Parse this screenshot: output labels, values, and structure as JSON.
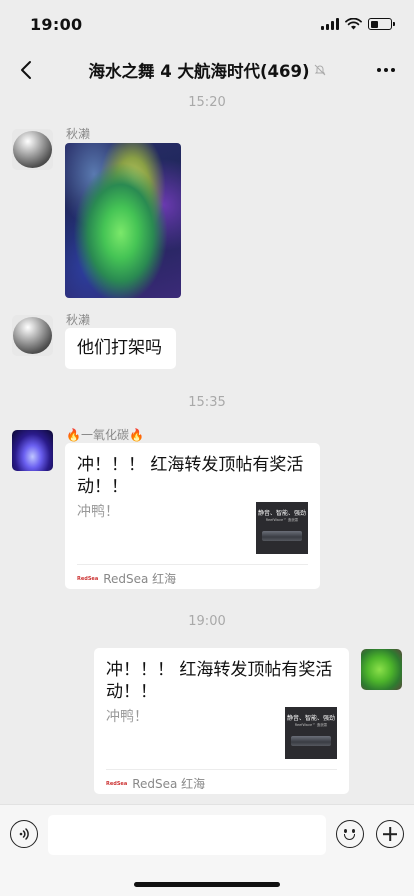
{
  "status_bar": {
    "time": "19:00"
  },
  "nav": {
    "title": "海水之舞 4 大航海时代(469)"
  },
  "messages": {
    "ts1": "15:20",
    "m1": {
      "sender": "秋濑"
    },
    "m2": {
      "sender": "秋濑",
      "text": "他们打架吗"
    },
    "ts2": "15:35",
    "m3": {
      "sender_prefix": "🔥",
      "sender_name": "一氧化碳",
      "sender_suffix": "🔥",
      "title_line1": "冲！！！ 红海转发顶帖有奖活",
      "title_line2": "动！！",
      "desc": "冲鸭！",
      "thumb_text": "静音、智能、强劲",
      "thumb_sub": "ReefWave™ 造浪泵",
      "source_logo": "RedSea",
      "source": "RedSea 红海"
    },
    "ts3": "19:00",
    "m4": {
      "title_line1": "冲！！！ 红海转发顶帖有奖活",
      "title_line2": "动！！",
      "desc": "冲鸭！",
      "thumb_text": "静音、智能、强劲",
      "thumb_sub": "ReefWave™ 造浪泵",
      "source_logo": "RedSea",
      "source": "RedSea 红海"
    }
  },
  "colors": {
    "background": "#ededed",
    "bubble": "#ffffff",
    "timestamp": "#a9a9a9"
  }
}
